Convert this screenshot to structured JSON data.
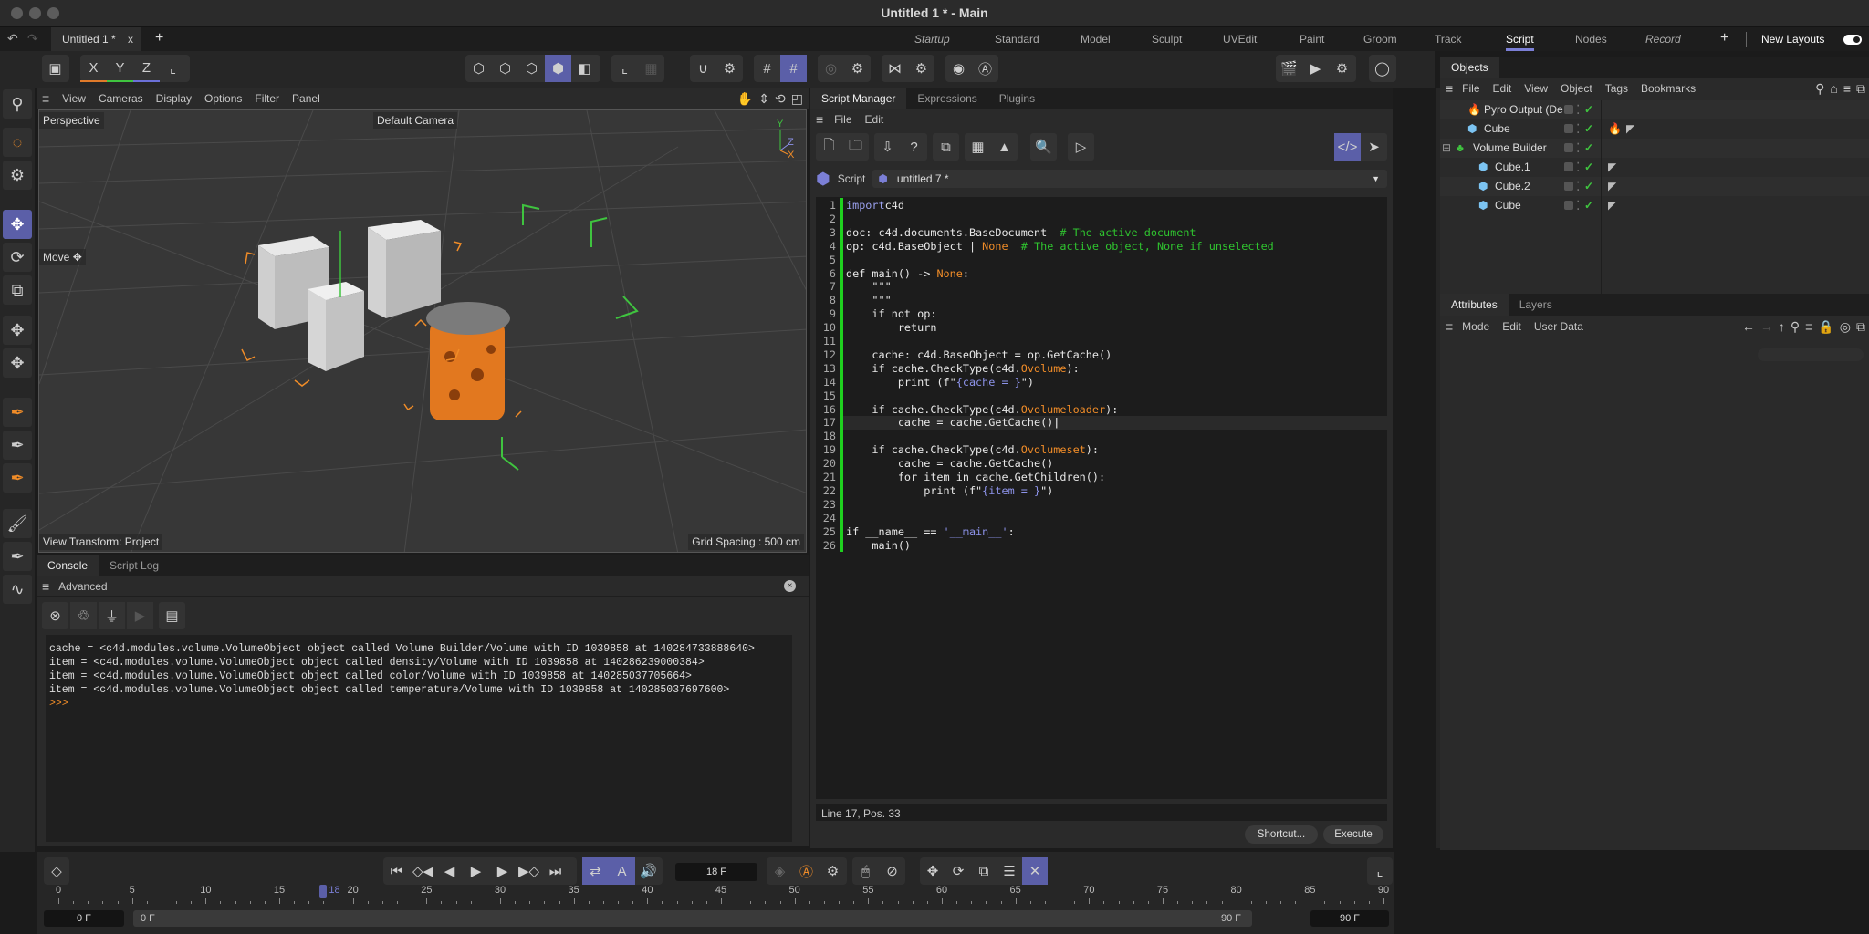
{
  "window": {
    "title": "Untitled 1 * - Main"
  },
  "doc_tab": {
    "label": "Untitled 1 *",
    "close": "x",
    "add": "+"
  },
  "layouts": {
    "items": [
      {
        "label": "Startup",
        "italic": true
      },
      {
        "label": "Standard"
      },
      {
        "label": "Model"
      },
      {
        "label": "Sculpt"
      },
      {
        "label": "UVEdit"
      },
      {
        "label": "Paint"
      },
      {
        "label": "Groom"
      },
      {
        "label": "Track"
      },
      {
        "label": "Script",
        "active": true
      },
      {
        "label": "Nodes"
      },
      {
        "label": "Record",
        "italic": true
      }
    ],
    "add": "+",
    "new_layouts": "New Layouts"
  },
  "toolbar": {
    "x": "X",
    "y": "Y",
    "z": "Z"
  },
  "viewport": {
    "menu": [
      "View",
      "Cameras",
      "Display",
      "Options",
      "Filter",
      "Panel"
    ],
    "projection": "Perspective",
    "camera": "Default Camera",
    "tool": "Move",
    "view_transform": "View Transform: Project",
    "grid_spacing": "Grid Spacing : 500 cm",
    "axis": {
      "y": "Y",
      "z": "Z",
      "x": "X"
    }
  },
  "console": {
    "tabs": [
      "Console",
      "Script Log"
    ],
    "mode": "Advanced",
    "lines": [
      "cache = <c4d.modules.volume.VolumeObject object called Volume Builder/Volume with ID 1039858 at 140284733888640>",
      "item = <c4d.modules.volume.VolumeObject object called density/Volume with ID 1039858 at 140286239000384>",
      "item = <c4d.modules.volume.VolumeObject object called color/Volume with ID 1039858 at 140285037705664>",
      "item = <c4d.modules.volume.VolumeObject object called temperature/Volume with ID 1039858 at 140285037697600>"
    ],
    "prompt": ">>>"
  },
  "script_manager": {
    "tabs": [
      "Script Manager",
      "Expressions",
      "Plugins"
    ],
    "menu": [
      "File",
      "Edit"
    ],
    "script_label": "Script",
    "script_name": "untitled 7 *",
    "status": "Line 17, Pos. 33",
    "shortcut_btn": "Shortcut...",
    "execute_btn": "Execute",
    "code": [
      [
        [
          "kw",
          "import"
        ],
        [
          "",
          "c4d"
        ]
      ],
      [],
      [
        [
          "",
          "doc: c4d.documents.BaseDocument  "
        ],
        [
          "cm",
          "# The active document"
        ]
      ],
      [
        [
          "",
          "op: c4d.BaseObject | "
        ],
        [
          "or",
          "None"
        ],
        [
          "",
          "  "
        ],
        [
          "cm",
          "# The active object, None if unselected"
        ]
      ],
      [],
      [
        [
          "",
          "def main() -> "
        ],
        [
          "or",
          "None"
        ],
        [
          "",
          ":"
        ]
      ],
      [
        [
          "",
          "    \"\"\""
        ]
      ],
      [
        [
          "",
          "    \"\"\""
        ]
      ],
      [
        [
          "",
          "    if not op:"
        ]
      ],
      [
        [
          "",
          "        return"
        ]
      ],
      [],
      [
        [
          "",
          "    cache: c4d.BaseObject = op.GetCache()"
        ]
      ],
      [
        [
          "",
          "    if cache.CheckType(c4d."
        ],
        [
          "or",
          "Ovolume"
        ],
        [
          "",
          "):"
        ]
      ],
      [
        [
          "",
          "        print (f\""
        ],
        [
          "st",
          "{cache = }"
        ],
        [
          "",
          "\")"
        ]
      ],
      [],
      [
        [
          "",
          "    if cache.CheckType(c4d."
        ],
        [
          "or",
          "Ovolumeloader"
        ],
        [
          "",
          "):"
        ]
      ],
      [
        [
          "",
          "        cache = cache.GetCache()"
        ]
      ],
      [],
      [
        [
          "",
          "    if cache.CheckType(c4d."
        ],
        [
          "or",
          "Ovolumeset"
        ],
        [
          "",
          "):"
        ]
      ],
      [
        [
          "",
          "        cache = cache.GetCache()"
        ]
      ],
      [
        [
          "",
          "        for item in cache.GetChildren():"
        ]
      ],
      [
        [
          "",
          "            print (f\""
        ],
        [
          "st",
          "{item = }"
        ],
        [
          "",
          "\")"
        ]
      ],
      [],
      [],
      [
        [
          "",
          "if __name__ == "
        ],
        [
          "st",
          "'__main__'"
        ],
        [
          "",
          ":"
        ]
      ],
      [
        [
          "",
          "    main()"
        ]
      ]
    ]
  },
  "objects": {
    "tab": "Objects",
    "menu": [
      "File",
      "Edit",
      "View",
      "Object",
      "Tags",
      "Bookmarks"
    ],
    "items": [
      {
        "name": "Pyro Output (De",
        "icon": "fire",
        "indent": 1,
        "tags": []
      },
      {
        "name": "Cube",
        "icon": "cube",
        "indent": 1,
        "tags": [
          "pyro",
          "phong"
        ]
      },
      {
        "name": "Volume Builder",
        "icon": "volume",
        "indent": 0,
        "tags": []
      },
      {
        "name": "Cube.1",
        "icon": "cube",
        "indent": 2,
        "tags": [
          "phong"
        ]
      },
      {
        "name": "Cube.2",
        "icon": "cube",
        "indent": 2,
        "tags": [
          "phong"
        ]
      },
      {
        "name": "Cube",
        "icon": "cube",
        "indent": 2,
        "tags": [
          "phong"
        ]
      }
    ]
  },
  "attributes": {
    "tabs": [
      "Attributes",
      "Layers"
    ],
    "menu": [
      "Mode",
      "Edit",
      "User Data"
    ]
  },
  "timeline": {
    "current_frame": "18 F",
    "playhead": 18,
    "ticks": [
      0,
      5,
      10,
      15,
      20,
      25,
      30,
      35,
      40,
      45,
      50,
      55,
      60,
      65,
      70,
      75,
      80,
      85,
      90
    ],
    "range_min": 0,
    "range_max": 90,
    "start": "0 F",
    "preview_start": "0 F",
    "preview_end": "90 F",
    "end": "90 F"
  },
  "colors": {
    "accent": "#5b5fa8",
    "green": "#1fd11f",
    "orange": "#f08c28"
  }
}
